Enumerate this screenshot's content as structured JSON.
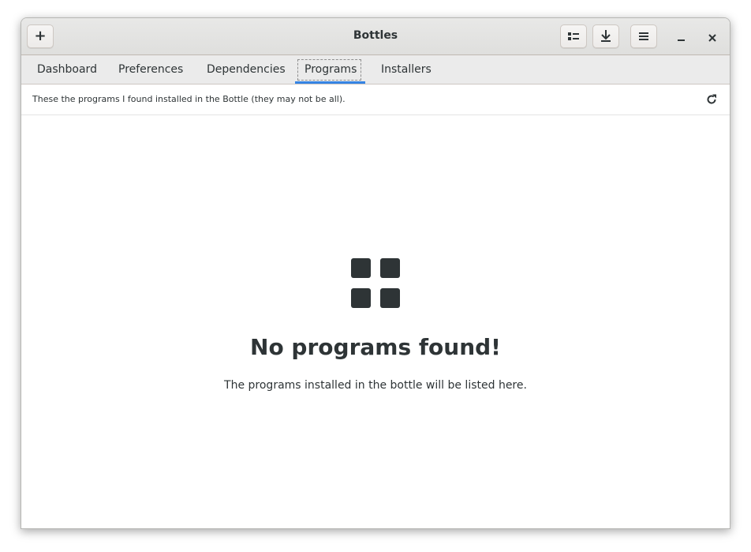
{
  "window": {
    "title": "Bottles"
  },
  "headerbar": {
    "add_label": "+",
    "add_icon": "plus-icon",
    "list_icon": "list-view-icon",
    "download_icon": "download-icon",
    "menu_icon": "hamburger-menu-icon",
    "minimize_icon": "minimize-icon",
    "close_icon": "close-icon"
  },
  "tabs": [
    {
      "label": "Dashboard",
      "active": false
    },
    {
      "label": "Preferences",
      "active": false
    },
    {
      "label": "Dependencies",
      "active": false
    },
    {
      "label": "Programs",
      "active": true
    },
    {
      "label": "Installers",
      "active": false
    }
  ],
  "programs": {
    "info_text": "These the programs I found installed in the Bottle (they may not be all).",
    "refresh_icon": "refresh-icon",
    "empty_icon": "grid-apps-icon",
    "empty_title": "No programs found!",
    "empty_description": "The programs installed in the bottle will be listed here."
  },
  "colors": {
    "accent": "#3584e4",
    "text": "#2e3436",
    "headerbar": "#e4e3e1"
  }
}
